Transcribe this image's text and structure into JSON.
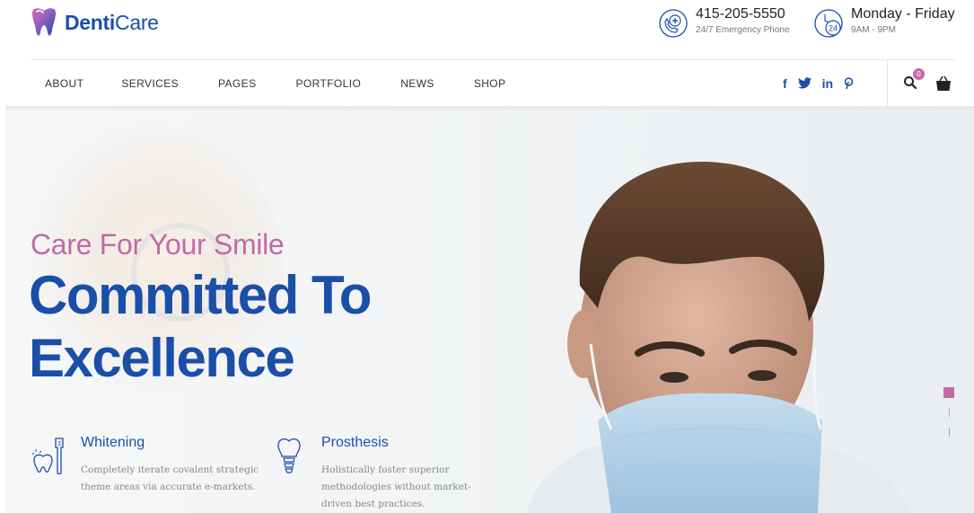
{
  "brand": {
    "name_bold": "Denti",
    "name_light": "Care"
  },
  "contact": {
    "phone": "415-205-5550",
    "phone_sub": "24/7 Emergency Phone",
    "hours": "Monday - Friday",
    "hours_sub": "9AM - 9PM",
    "hours_icon_label": "24"
  },
  "nav": {
    "items": [
      "ABOUT",
      "SERVICES",
      "PAGES",
      "PORTFOLIO",
      "NEWS",
      "SHOP"
    ]
  },
  "social": {
    "facebook": "f",
    "linkedin": "in"
  },
  "cart": {
    "count": "0"
  },
  "hero": {
    "tagline": "Care For Your Smile",
    "headline_line1": "Committed To",
    "headline_line2": "Excellence",
    "features": [
      {
        "title": "Whitening",
        "description": "Completely iterate covalent strategic theme areas via accurate e-markets.",
        "icon": "tooth-whitening-icon"
      },
      {
        "title": "Prosthesis",
        "description": "Holistically foster superior methodologies without market-driven best practices.",
        "icon": "tooth-implant-icon"
      }
    ]
  },
  "colors": {
    "primary": "#1a4fa8",
    "accent": "#c06aa8"
  },
  "icons": {
    "phone": "emergency-phone-icon",
    "hours": "clock-24-icon",
    "search": "search-icon",
    "cart": "cart-icon",
    "twitter": "twitter-icon",
    "pinterest": "pinterest-icon"
  }
}
